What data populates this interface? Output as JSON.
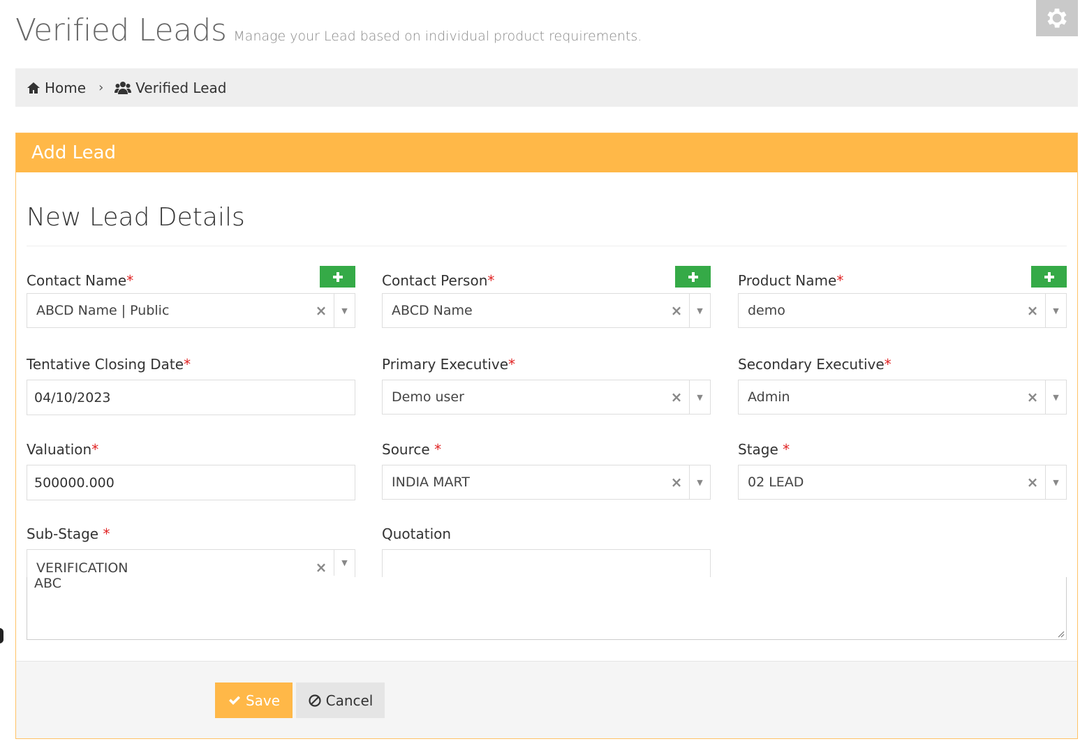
{
  "header": {
    "title": "Verified Leads",
    "subtitle": "Manage your Lead based on individual product requirements."
  },
  "breadcrumb": {
    "home": "Home",
    "current": "Verified Lead"
  },
  "portlet": {
    "title": "Add Lead",
    "section_title": "New Lead Details"
  },
  "fields": {
    "contact_name": {
      "label": "Contact Name",
      "required": "*",
      "value": "ABCD Name | Public"
    },
    "contact_person": {
      "label": "Contact Person",
      "required": "*",
      "value": "ABCD Name"
    },
    "product_name": {
      "label": "Product Name",
      "required": "*",
      "value": "demo"
    },
    "closing_date": {
      "label": "Tentative Closing Date",
      "required": "*",
      "value": "04/10/2023"
    },
    "primary_exec": {
      "label": "Primary Executive",
      "required": "*",
      "value": "Demo user"
    },
    "secondary_exec": {
      "label": "Secondary Executive",
      "required": "*",
      "value": "Admin"
    },
    "valuation": {
      "label": "Valuation",
      "required": "*",
      "value": "500000.000"
    },
    "source": {
      "label": "Source ",
      "required": "*",
      "value": "INDIA MART"
    },
    "stage": {
      "label": "Stage ",
      "required": "*",
      "value": "02 LEAD"
    },
    "sub_stage": {
      "label": "Sub-Stage ",
      "required": "*",
      "value": "VERIFICATION"
    },
    "quotation": {
      "label": "Quotation",
      "value": ""
    },
    "notes": {
      "value": "ABC"
    }
  },
  "actions": {
    "save": "Save",
    "cancel": "Cancel"
  },
  "icons": {
    "clear": "×",
    "arrow": "▼",
    "plus": "plus-icon",
    "gear": "gear-icon",
    "home": "home-icon",
    "users": "users-icon",
    "check": "check-icon",
    "ban": "ban-icon"
  },
  "colors": {
    "accent": "#ffb848",
    "add_button": "#35aa47",
    "required": "#e02222"
  }
}
